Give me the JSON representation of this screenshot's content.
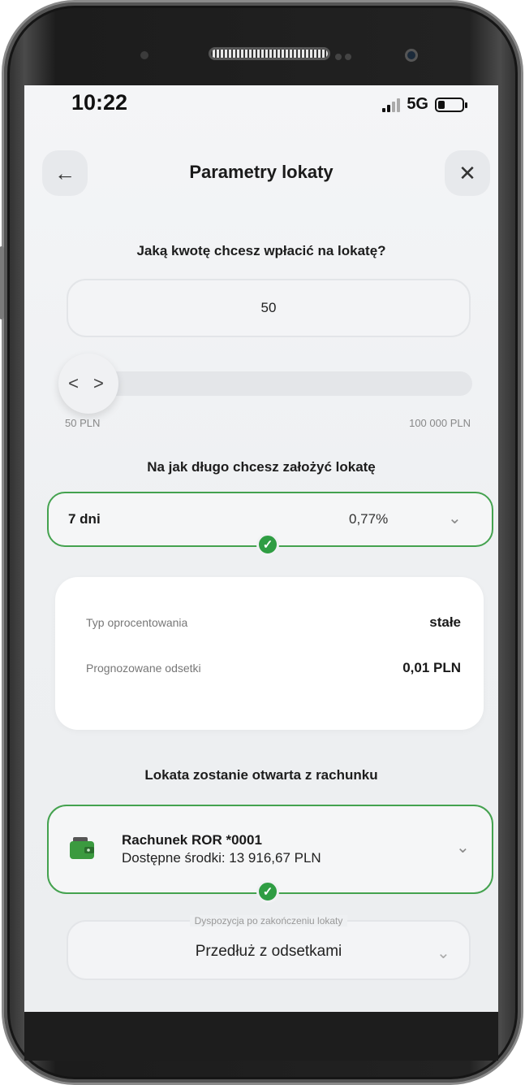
{
  "status_bar": {
    "time": "10:22",
    "network": "5G"
  },
  "header": {
    "back_icon": "arrow-left-icon",
    "title": "Parametry lokaty",
    "close_icon": "close-icon"
  },
  "amount": {
    "question": "Jaką kwotę chcesz wpłacić na lokatę?",
    "value": "50",
    "slider_handle": "< >",
    "min_label": "50 PLN",
    "max_label": "100 000 PLN"
  },
  "term": {
    "question": "Na jak długo chcesz założyć lokatę",
    "selected": "7 dni",
    "rate": "0,77%"
  },
  "details": {
    "rows": [
      {
        "label": "Typ oprocentowania",
        "value": "stałe"
      },
      {
        "label": "Prognozowane odsetki",
        "value": "0,01 PLN"
      }
    ]
  },
  "account": {
    "question": "Lokata zostanie otwarta z rachunku",
    "name": "Rachunek ROR *0001",
    "funds": "Dostępne środki: 13 916,67 PLN"
  },
  "disposition": {
    "label": "Dyspozycja po zakończeniu lokaty",
    "value": "Przedłuż z odsetkami"
  },
  "colors": {
    "accent_green": "#44a24f",
    "check_green": "#2f9d43"
  }
}
